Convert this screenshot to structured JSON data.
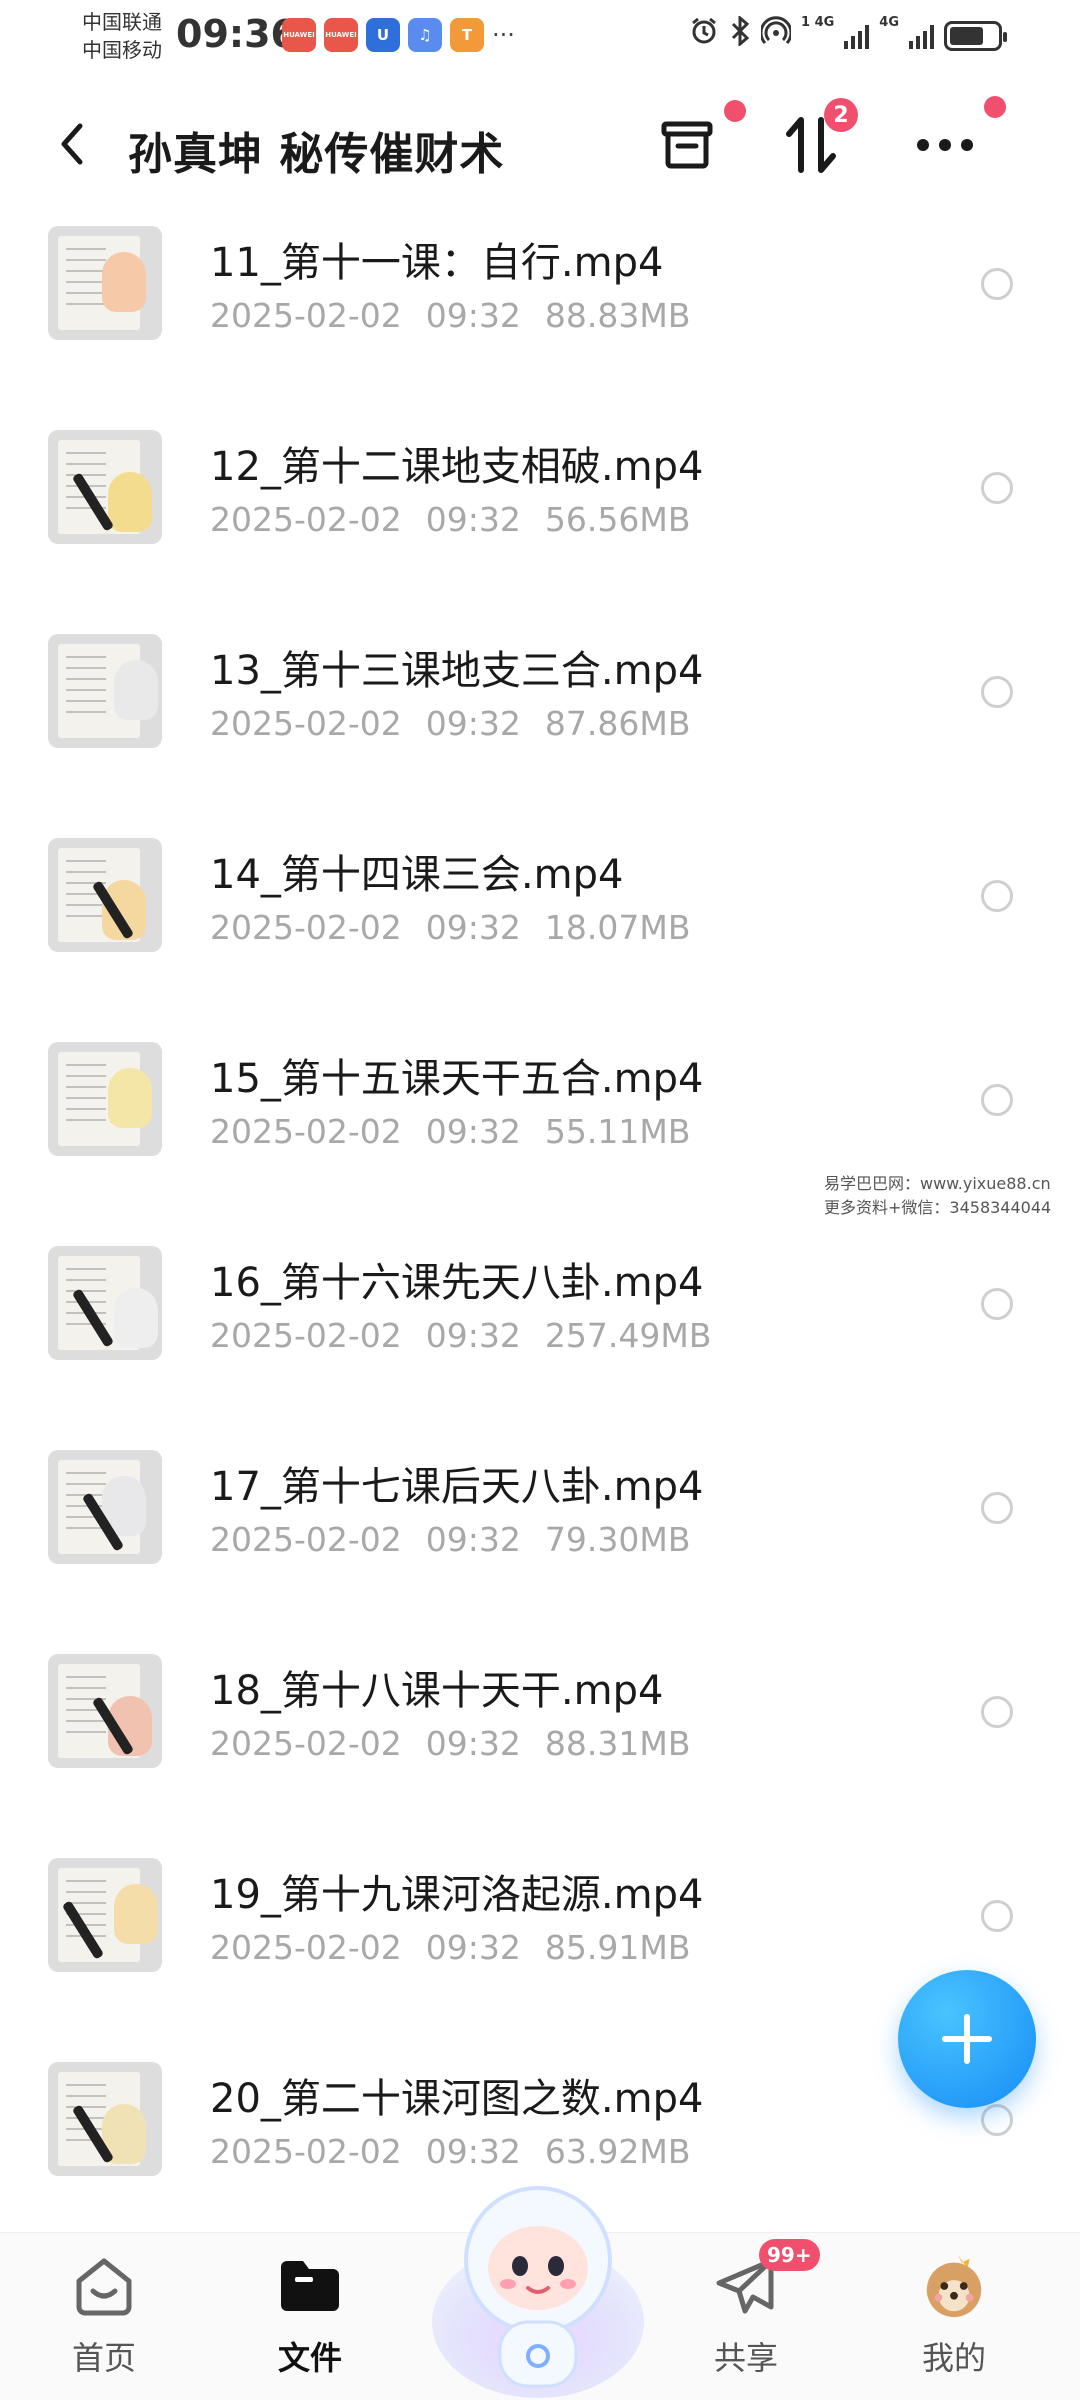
{
  "status_bar": {
    "carrier_1": "中国联通",
    "carrier_2": "中国移动",
    "time": "09:36",
    "notification_icons": [
      {
        "name": "huawei-app-icon",
        "color": "#e8574a",
        "label": "HUAWEI"
      },
      {
        "name": "huawei-app-icon",
        "color": "#e8574a",
        "label": "HUAWEI"
      },
      {
        "name": "app-u-icon",
        "color": "#2f6fdc",
        "label": "U"
      },
      {
        "name": "music-icon",
        "color": "#5a8cf0",
        "label": "♫"
      },
      {
        "name": "app-t-icon",
        "color": "#f29a3a",
        "label": "T"
      }
    ],
    "more_dots": "···",
    "net_1": "4G",
    "net_2": "4G",
    "net_sup_1": "1"
  },
  "header": {
    "title": "孙真坤 秘传催财术",
    "sort_badge": "2"
  },
  "files": [
    {
      "name": "11_第十一课：自行.mp4",
      "date": "2025-02-02",
      "time": "09:32",
      "size": "88.83MB",
      "thumb_tint": "#f6c9a8"
    },
    {
      "name": "12_第十二课地支相破.mp4",
      "date": "2025-02-02",
      "time": "09:32",
      "size": "56.56MB",
      "thumb_tint": "#f3dc8e"
    },
    {
      "name": "13_第十三课地支三合.mp4",
      "date": "2025-02-02",
      "time": "09:32",
      "size": "87.86MB",
      "thumb_tint": "#e9e9e9"
    },
    {
      "name": "14_第十四课三会.mp4",
      "date": "2025-02-02",
      "time": "09:32",
      "size": "18.07MB",
      "thumb_tint": "#f5d7a0"
    },
    {
      "name": "15_第十五课天干五合.mp4",
      "date": "2025-02-02",
      "time": "09:32",
      "size": "55.11MB",
      "thumb_tint": "#f4e6a6"
    },
    {
      "name": "16_第十六课先天八卦.mp4",
      "date": "2025-02-02",
      "time": "09:32",
      "size": "257.49MB",
      "thumb_tint": "#eeeeee"
    },
    {
      "name": "17_第十七课后天八卦.mp4",
      "date": "2025-02-02",
      "time": "09:32",
      "size": "79.30MB",
      "thumb_tint": "#e8e8ea"
    },
    {
      "name": "18_第十八课十天干.mp4",
      "date": "2025-02-02",
      "time": "09:32",
      "size": "88.31MB",
      "thumb_tint": "#f2c2b0"
    },
    {
      "name": "19_第十九课河洛起源.mp4",
      "date": "2025-02-02",
      "time": "09:32",
      "size": "85.91MB",
      "thumb_tint": "#f4dda8"
    },
    {
      "name": "20_第二十课河图之数.mp4",
      "date": "2025-02-02",
      "time": "09:32",
      "size": "63.92MB",
      "thumb_tint": "#f1e2b6"
    }
  ],
  "watermark": {
    "line1": "易学巴巴网：www.yixue88.cn",
    "line2": "更多资料+微信：3458344044"
  },
  "bottom_nav": {
    "home": "首页",
    "files": "文件",
    "share": "共享",
    "share_badge": "99+",
    "mine": "我的"
  },
  "colors": {
    "accent": "#168cf5",
    "badge": "#f0506e",
    "meta_text": "#a8a8a8"
  }
}
